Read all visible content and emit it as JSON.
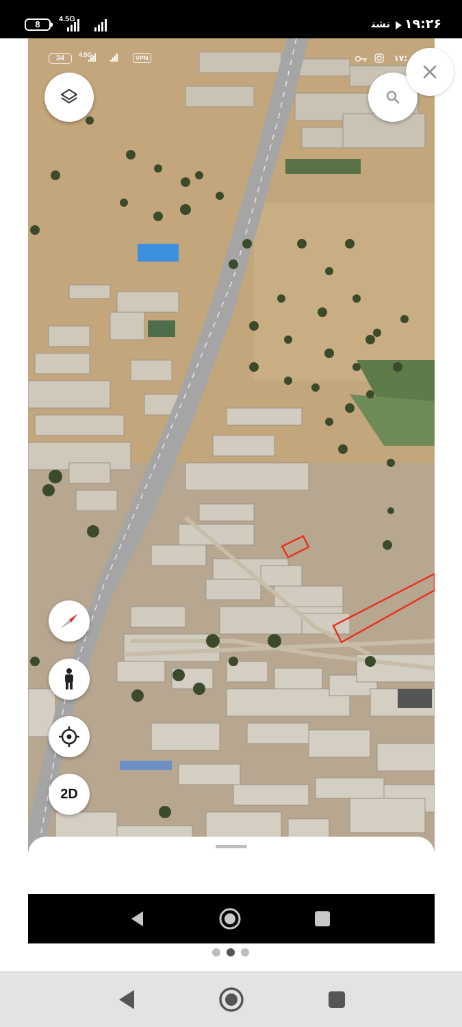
{
  "device_status": {
    "battery": "8",
    "network": "4.5G",
    "carrier": "ﺗﺸﺘ",
    "time": "۱۹:۲۶"
  },
  "screenshot_status": {
    "battery": "34",
    "network": "4.5G",
    "vpn": "VPN",
    "time_partial": "۱۷:"
  },
  "map_controls": {
    "layers": "layers-icon",
    "search": "search-icon",
    "close": "close-icon",
    "compass": "compass-icon",
    "street_view": "person-icon",
    "my_location": "crosshair-icon",
    "view_mode_label": "2D"
  },
  "pager": {
    "count": 3,
    "active_index": 1
  },
  "colors": {
    "parcel_outline": "#e8321d",
    "blue_roof": "#3d8fe0",
    "nav_bar_dark": "#000000",
    "nav_bar_light": "#e3e3e3"
  }
}
